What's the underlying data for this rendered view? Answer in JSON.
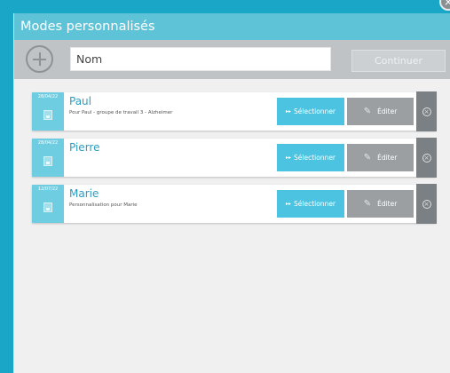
{
  "dialog": {
    "title": "Modes personnalisés",
    "close_icon": "close-icon"
  },
  "toolbar": {
    "add_icon": "plus-circle-icon",
    "name_input_value": "Nom",
    "continue_label": "Continuer"
  },
  "modes": [
    {
      "date": "28/04/22",
      "name": "Paul",
      "description": "Pour Paul - groupe de travail 3 - Alzheimer",
      "select_label": "Sélectionner",
      "edit_label": "Éditer"
    },
    {
      "date": "28/04/22",
      "name": "Pierre",
      "description": "",
      "select_label": "Sélectionner",
      "edit_label": "Éditer"
    },
    {
      "date": "12/07/22",
      "name": "Marie",
      "description": "Personnalisation pour Marie",
      "select_label": "Sélectionner",
      "edit_label": "Éditer"
    }
  ],
  "colors": {
    "background": "#1aa6c6",
    "titlebar": "#5fc3d8",
    "select_button": "#4cc3e0",
    "edit_button": "#9b9fa2",
    "delete_button": "#7b8085"
  }
}
